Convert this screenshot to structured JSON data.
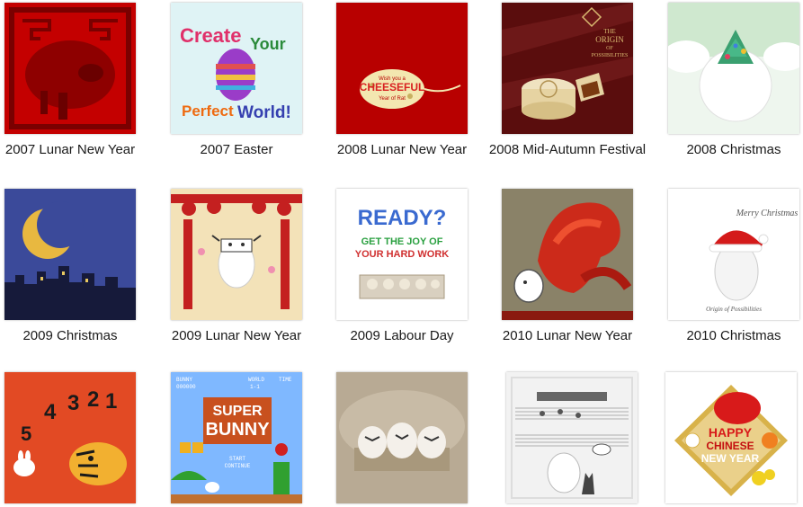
{
  "gallery": {
    "items": [
      {
        "caption": "2007 Lunar New Year",
        "icon": "pig-ornament-icon"
      },
      {
        "caption": "2007 Easter",
        "icon": "easter-egg-icon",
        "art": {
          "line1": "Create",
          "line2": "Your",
          "line3": "Perfect",
          "line4": "World!"
        }
      },
      {
        "caption": "2008 Lunar New Year",
        "icon": "cheese-mouse-icon",
        "art": {
          "top": "Wish you a",
          "main": "CHEESEFUL",
          "bottom": "Year of Rat"
        }
      },
      {
        "caption": "2008 Mid-Autumn Festival",
        "icon": "mooncake-icon",
        "art": {
          "line1": "THE",
          "line2": "ORIGIN",
          "line3": "OF",
          "line4": "POSSIBILITIES"
        }
      },
      {
        "caption": "2008 Christmas",
        "icon": "christmas-tree-egg-icon"
      },
      {
        "caption": "2009 Christmas",
        "icon": "crescent-moon-icon"
      },
      {
        "caption": "2009 Lunar New Year",
        "icon": "ox-egg-lanterns-icon"
      },
      {
        "caption": "2009 Labour Day",
        "icon": "egg-carton-icon",
        "art": {
          "main": "READY?",
          "line2": "GET THE JOY OF",
          "line3": "YOUR HARD WORK"
        }
      },
      {
        "caption": "2010 Lunar New Year",
        "icon": "tiger-egg-icon"
      },
      {
        "caption": "2010 Christmas",
        "icon": "santa-hat-egg-icon",
        "art": {
          "top": "Merry Christmas",
          "bottom": "Origin of Possibilities"
        }
      },
      {
        "caption": "",
        "icon": "tiger-countdown-icon",
        "art": {
          "digits": [
            "5",
            "4",
            "3",
            "2",
            "1"
          ]
        }
      },
      {
        "caption": "",
        "icon": "super-bunny-icon",
        "art": {
          "hud_left": "BUNNY",
          "hud_mid": "WORLD",
          "hud_right": "TIME",
          "hud_left_val": "000000",
          "hud_mid_val": "1-1",
          "title1": "SUPER",
          "title2": "BUNNY",
          "menu1": "START",
          "menu2": "CONTINUE"
        }
      },
      {
        "caption": "",
        "icon": "eggs-in-carton-icon"
      },
      {
        "caption": "",
        "icon": "music-egg-cat-icon"
      },
      {
        "caption": "",
        "icon": "chinese-new-year-diamond-icon",
        "art": {
          "line1": "HAPPY",
          "line2": "CHINESE",
          "line3": "NEW YEAR"
        }
      }
    ]
  },
  "colors": {
    "caption": "#1a1a1a",
    "red_dark": "#b00000",
    "easter_bg": "#dff3f5",
    "night_sky": "#3b4a9a"
  }
}
